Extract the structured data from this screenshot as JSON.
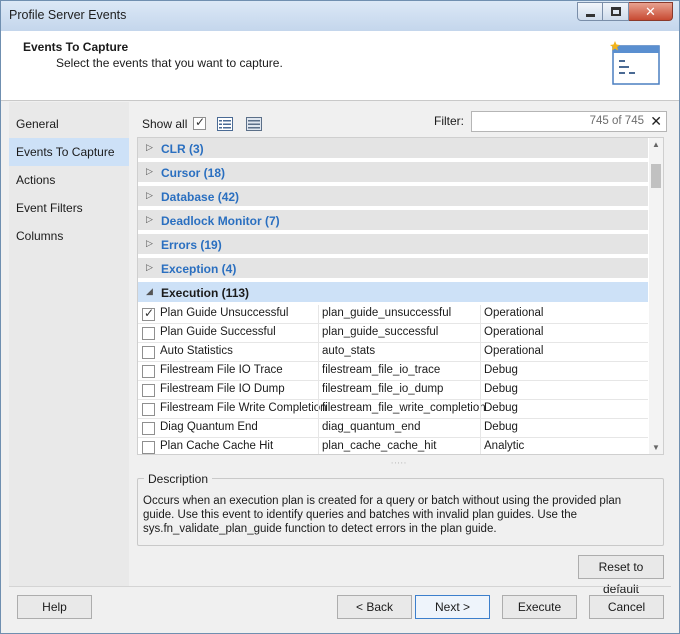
{
  "window": {
    "title": "Profile Server Events",
    "minimize_icon": "minimize-icon",
    "maximize_icon": "maximize-icon",
    "close_icon": "close-icon",
    "close_glyph": "✕"
  },
  "header": {
    "title": "Events To Capture",
    "subtitle": "Select the events that you want to capture.",
    "icon": "event-list-icon"
  },
  "sidebar": {
    "items": [
      {
        "label": "General",
        "active": false
      },
      {
        "label": "Events To Capture",
        "active": true
      },
      {
        "label": "Actions",
        "active": false
      },
      {
        "label": "Event Filters",
        "active": false
      },
      {
        "label": "Columns",
        "active": false
      }
    ]
  },
  "toolbar": {
    "show_all_label": "Show all",
    "show_all_checked": true,
    "filter_label": "Filter:",
    "filter_value": "",
    "filter_count": "745 of 745",
    "clear_glyph": "✕"
  },
  "groups": [
    {
      "name": "CLR (3)",
      "expanded": false
    },
    {
      "name": "Cursor (18)",
      "expanded": false
    },
    {
      "name": "Database (42)",
      "expanded": false
    },
    {
      "name": "Deadlock Monitor (7)",
      "expanded": false
    },
    {
      "name": "Errors (19)",
      "expanded": false
    },
    {
      "name": "Exception (4)",
      "expanded": false
    },
    {
      "name": "Execution (113)",
      "expanded": true
    }
  ],
  "events": [
    {
      "name": "Plan Guide Unsuccessful",
      "id": "plan_guide_unsuccessful",
      "channel": "Operational",
      "checked": true
    },
    {
      "name": "Plan Guide Successful",
      "id": "plan_guide_successful",
      "channel": "Operational",
      "checked": false
    },
    {
      "name": "Auto Statistics",
      "id": "auto_stats",
      "channel": "Operational",
      "checked": false
    },
    {
      "name": "Filestream File IO Trace",
      "id": "filestream_file_io_trace",
      "channel": "Debug",
      "checked": false
    },
    {
      "name": "Filestream File IO Dump",
      "id": "filestream_file_io_dump",
      "channel": "Debug",
      "checked": false
    },
    {
      "name": "Filestream File Write Completion",
      "id": "filestream_file_write_completion",
      "channel": "Debug",
      "checked": false
    },
    {
      "name": "Diag Quantum End",
      "id": "diag_quantum_end",
      "channel": "Debug",
      "checked": false
    },
    {
      "name": "Plan Cache Cache Hit",
      "id": "plan_cache_cache_hit",
      "channel": "Analytic",
      "checked": false
    }
  ],
  "description": {
    "label": "Description",
    "text": "Occurs when an execution plan is created for a query or batch without using the provided plan guide. Use this event to identify queries and batches with invalid plan guides. Use the sys.fn_validate_plan_guide function to detect errors in the plan guide."
  },
  "buttons": {
    "reset": "Reset to default",
    "help": "Help",
    "back": "< Back",
    "next": "Next >",
    "execute": "Execute",
    "cancel": "Cancel"
  },
  "colors": {
    "group_link": "#2a6fc0",
    "selection": "#cde1f7",
    "close_button": "#c74a32"
  }
}
